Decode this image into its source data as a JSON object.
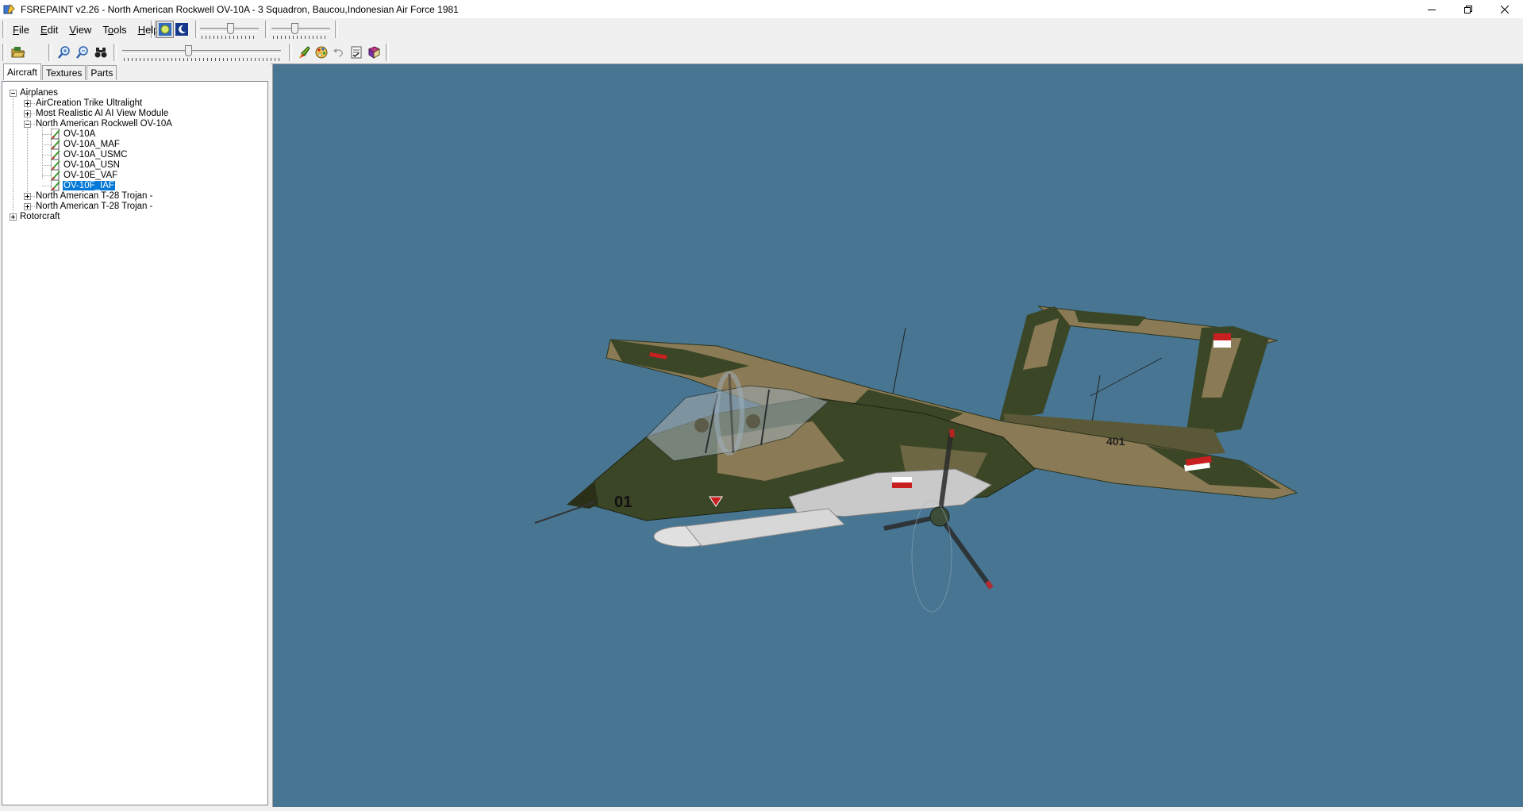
{
  "window": {
    "title": "FSREPAINT v2.26 - North American Rockwell OV-10A - 3 Squadron, Baucou,Indonesian Air Force 1981"
  },
  "menu": {
    "file": {
      "accel": "F",
      "rest": "ile"
    },
    "edit": {
      "accel": "E",
      "rest": "dit"
    },
    "view": {
      "accel": "V",
      "rest": "iew"
    },
    "tools": {
      "pre": "T",
      "accel": "o",
      "rest": "ols"
    },
    "help": {
      "accel": "H",
      "rest": "elp"
    }
  },
  "tabs": {
    "aircraft": "Aircraft",
    "textures": "Textures",
    "parts": "Parts"
  },
  "tree": {
    "airplanes": "Airplanes",
    "aircreation": "AirCreation Trike Ultralight",
    "most_realistic": "Most Realistic AI AI View Module",
    "ov10_group": "North American Rockwell OV-10A",
    "ov10_children": [
      "OV-10A",
      "OV-10A_MAF",
      "OV-10A_USMC",
      "OV-10A_USN",
      "OV-10E_VAF",
      "OV-10F_IAF"
    ],
    "selected_child": "OV-10F_IAF",
    "t28_a": "North American T-28 Trojan -",
    "t28_b": "North American T-28 Trojan -",
    "rotorcraft": "Rotorcraft"
  },
  "aircraft_render": {
    "nose_number": "01",
    "tail_number": "401"
  },
  "colors": {
    "viewport_bg": "#477592",
    "selection": "#0078d7",
    "camo_dark": "#3b4626",
    "camo_tan": "#8a7a55"
  },
  "icons": {
    "app": "paint-icon",
    "open": "open-folder-icon",
    "zoom_in": "zoom-in-icon",
    "zoom_out": "zoom-out-icon",
    "find": "binoculars-icon",
    "day": "sun-icon",
    "night": "moon-icon"
  }
}
